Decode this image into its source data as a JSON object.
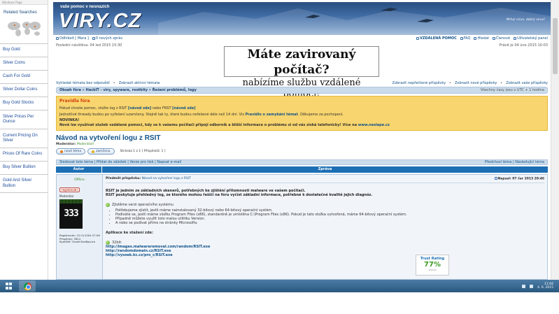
{
  "sidebar": {
    "window_title": "Windows Page",
    "heading": "Related Searches",
    "items": [
      "Buy Gold",
      "Silver Coins",
      "Cash For Gold",
      "Silver Dollar Coins",
      "Buy Gold Stocks",
      "Silver Prices Per Ounce",
      "Current Pricing On Silver",
      "Prices Of Rare Coins",
      "Buy Silver Bullion",
      "Gold And Silver Bullion"
    ]
  },
  "banner": {
    "top_text": "vaše pomoc v nesnazích",
    "logo": "VIRY.CZ",
    "slogan": "Mrtvý virus, dobrý virus!"
  },
  "nav": {
    "logout": "Odhlásit [ Mara ]",
    "messages": "0 nových zpráv",
    "remote_help": "VZDÁLENÁ POMOC",
    "faq": "FAQ",
    "search": "Hledat",
    "members": "Členové",
    "user_panel": "Uživatelský panel",
    "last_visit": "Poslední návštěva: 04 led 2015 15:30",
    "now": "Právě je 04 úno 2015 10:03"
  },
  "ad": {
    "line1": "Máte zavirovaný počítač?",
    "line2": "nabízíme službu vzdálené pomoci!"
  },
  "links": {
    "left": [
      "Vyhledat témata bez odpovědí",
      "Zobrazit aktivní témata"
    ],
    "right": [
      "Zobrazit nepřečtené příspěvky",
      "Zobrazit nové příspěvky",
      "Zobrazit vaše příspěvky"
    ]
  },
  "breadcrumb": {
    "path": "Obsah fóra » HackIT - viry, spyware, rootkity » Řešení problémů, logy",
    "timezone": "Všechny časy jsou v UTC + 1 hodina"
  },
  "rules": {
    "title": "Pravidla fóra",
    "p1_a": "Pokud chcete pomoc, vložte log z RSIT",
    "p1_link1": "[návod zde]",
    "p1_b": "nebo FRST",
    "p1_link2": "[návod zde]",
    "p2_a": "Jednotlivé thready budou po vyřešení uzamčeny. Stejně tak ty, které budou neřešené déle než 14 dní. Viz",
    "p2_link": "Pravidlo o zamykání témat",
    "p2_b": ". Děkujeme za pochopení.",
    "p3_head": "NOVINKA!",
    "p3_a": "Nově lze využívat služeb vzdálené pomoci, kdy se k vašemu počítači připojí odborník a bližší informace o problému si od vás získá telefonicky! Více na",
    "p3_link": "www.neslape.cz"
  },
  "topic": {
    "title": "Návod na vytvoření logu z RSIT",
    "moderator_label": "Moderátor:",
    "moderator": "Moderátoři",
    "new_topic": "nové téma",
    "locked": "zamčeno",
    "pager": "Stránka 1 z 1  [ Příspěvků: 1 ]"
  },
  "topic_bar": {
    "left": "Sledovat toto téma | Přidat do záložek | Verze pro tisk | Napsat e-mail",
    "right": "Předchozí téma | Následující téma"
  },
  "table": {
    "author_header": "Autor",
    "message_header": "Zpráva"
  },
  "author": {
    "status": "Offline",
    "pm": "registrován",
    "role": "Moderátor",
    "avatar_text": "333",
    "registered": "Registrován: 20 říj 2004 07:06",
    "posts": "Příspěvky: 3624",
    "residence": "Bydliště: České Budějovice"
  },
  "post": {
    "subject_label": "Předmět příspěvku:",
    "subject": "Návod na vytvoření logu z RSIT",
    "date": "Napsal: 07 čer 2013 20:46",
    "intro": "RSIT je jedním ze základních skenerů, potřebných ke zjištění přítomnosti malware ve vašem počítači.",
    "intro2": "RSIT poskytuje přehledný log, ze kterého mohou řešiči na fóru vyčíst základní informace, potřebné k dostatečné kvalitě jejich diagnóz.",
    "sec1": "Zjistěme verzi operačního systému",
    "bullets": [
      "Potřebujeme zjistit, jestli máme nainstalovaný 32-bitový nebo 64-bitový operační systém.",
      "Podíváte se, jestli máme složku Program Files (x86), standardně je umístěna C:\\Program Files (x86). Pokud je tato složka vytvořená, máme 64-bitový operační systém.",
      "Případně můžete využít toto malou utilitku Version.",
      "A nebo se podívat přímo na stránky Microsoftu"
    ],
    "sec2": "Aplikace ke stažení zde:",
    "sec3": "32bit:",
    "dl_links": [
      "http://images.malwareremoval.com/random/RSIT.exe",
      "http://randomdomain.cz/RSIT.exe",
      "http://vysoek.kc.cz/pro_c/RSIT.exe"
    ]
  },
  "trust": {
    "title": "Trust Rating",
    "value": "77%",
    "site": "viry.cz"
  },
  "taskbar": {
    "time": "11:04",
    "date": "4. 6. 2015"
  }
}
